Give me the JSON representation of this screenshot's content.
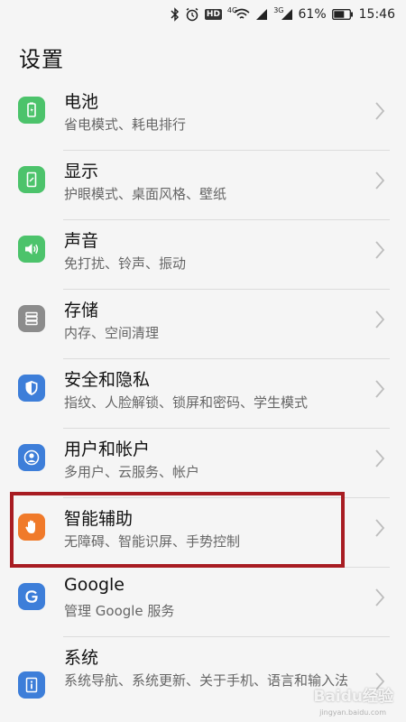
{
  "status_bar": {
    "net_4g": "4G",
    "net_3g": "3G",
    "battery_percent": "61%",
    "time": "15:46",
    "hd_label": "HD"
  },
  "header": {
    "title": "设置"
  },
  "items": [
    {
      "title": "电池",
      "subtitle": "省电模式、耗电排行",
      "icon": "battery-icon",
      "color": "#4cc36b"
    },
    {
      "title": "显示",
      "subtitle": "护眼模式、桌面风格、壁纸",
      "icon": "display-icon",
      "color": "#4cc36b"
    },
    {
      "title": "声音",
      "subtitle": "免打扰、铃声、振动",
      "icon": "speaker-icon",
      "color": "#4cc36b"
    },
    {
      "title": "存储",
      "subtitle": "内存、空间清理",
      "icon": "storage-icon",
      "color": "#8c8c8c"
    },
    {
      "title": "安全和隐私",
      "subtitle": "指纹、人脸解锁、锁屏和密码、学生模式",
      "icon": "shield-icon",
      "color": "#3d7ed9"
    },
    {
      "title": "用户和帐户",
      "subtitle": "多用户、云服务、帐户",
      "icon": "user-icon",
      "color": "#3d7ed9"
    },
    {
      "title": "智能辅助",
      "subtitle": "无障碍、智能识屏、手势控制",
      "icon": "hand-icon",
      "color": "#f07a2a"
    },
    {
      "title": "Google",
      "subtitle": "管理 Google 服务",
      "icon": "google-icon",
      "color": "#3d7ed9"
    },
    {
      "title": "系统",
      "subtitle": "系统导航、系统更新、关于手机、语言和输入法",
      "icon": "info-icon",
      "color": "#3d7ed9"
    }
  ],
  "watermark": {
    "text": "Baidu经验",
    "url": "jingyan.baidu.com"
  }
}
